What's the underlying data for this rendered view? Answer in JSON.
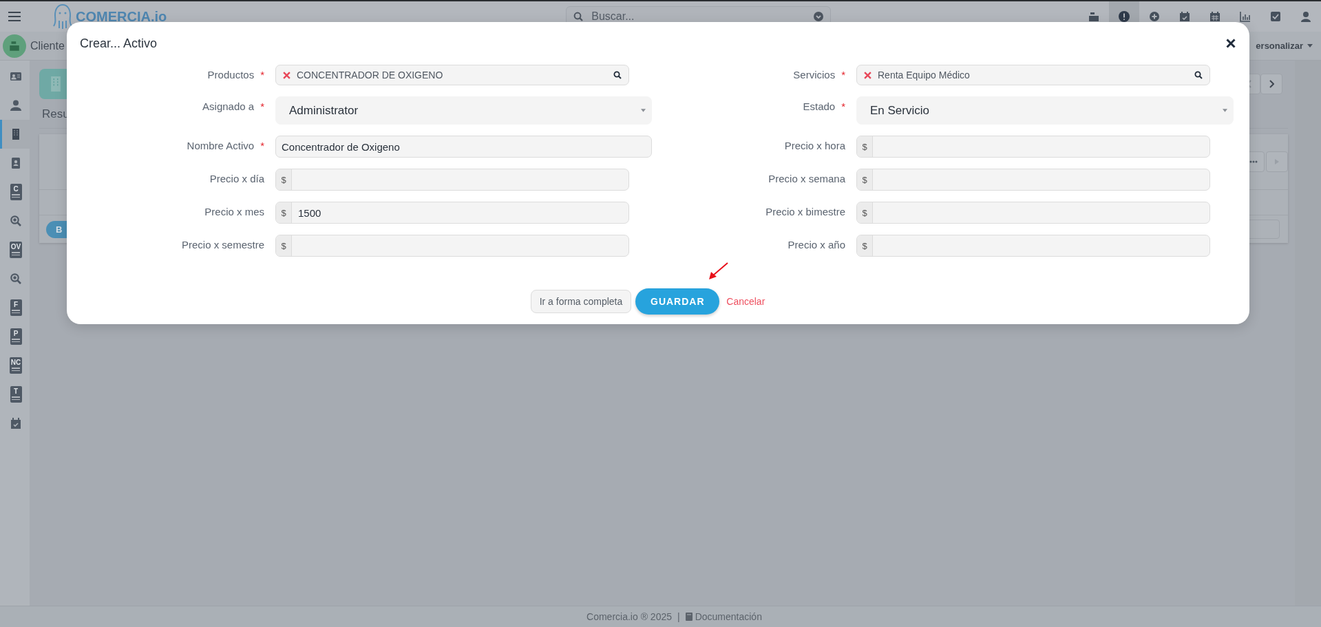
{
  "topbar": {
    "logo": "COMERCIA.io",
    "search": {
      "placeholder": "Buscar..."
    },
    "toolbar": [
      {
        "kind": "register",
        "selected": false
      },
      {
        "kind": "alert",
        "selected": true
      },
      {
        "kind": "plus",
        "selected": false
      },
      {
        "kind": "calendar-check",
        "selected": false
      },
      {
        "kind": "calendar",
        "selected": false
      },
      {
        "kind": "chart",
        "selected": false
      },
      {
        "kind": "checkbox",
        "selected": false
      },
      {
        "kind": "user",
        "selected": false
      }
    ]
  },
  "header": {
    "title": "Cliente",
    "menu": "ersonalizar"
  },
  "sidebar": {
    "items": [
      {
        "kind": "id-card",
        "selected": false
      },
      {
        "kind": "person",
        "selected": false
      },
      {
        "kind": "building",
        "selected": true
      },
      {
        "kind": "contact",
        "selected": false
      },
      {
        "kind": "doc",
        "letter": "C",
        "selected": false
      },
      {
        "kind": "money-search",
        "selected": false
      },
      {
        "kind": "doc",
        "letter": "OV",
        "selected": false
      },
      {
        "kind": "money-search",
        "selected": false
      },
      {
        "kind": "doc",
        "letter": "F",
        "selected": false
      },
      {
        "kind": "doc",
        "letter": "P",
        "selected": false
      },
      {
        "kind": "doc",
        "letter": "NC",
        "selected": false
      },
      {
        "kind": "doc",
        "letter": "T",
        "selected": false
      },
      {
        "kind": "calendar-check",
        "selected": false
      }
    ]
  },
  "background": {
    "tab": "Resu",
    "button": "B"
  },
  "modal": {
    "title": "Crear... Activo",
    "required_mark": "*",
    "left_column": [
      {
        "label": "Productos",
        "required": true,
        "kind": "lookup",
        "value": "CONCENTRADOR DE OXIGENO"
      },
      {
        "label": "Asignado a",
        "required": true,
        "kind": "select",
        "value": "Administrator"
      },
      {
        "label": "Nombre Activo",
        "required": true,
        "kind": "text",
        "value": "Concentrador de Oxigeno"
      },
      {
        "label": "Precio x día",
        "required": false,
        "kind": "money",
        "prefix": "$"
      },
      {
        "label": "Precio x mes",
        "required": false,
        "kind": "money",
        "prefix": "$",
        "value": "1500"
      },
      {
        "label": "Precio x semestre",
        "required": false,
        "kind": "money",
        "prefix": "$"
      }
    ],
    "right_column": [
      {
        "label": "Servicios",
        "required": true,
        "kind": "lookup",
        "value": "Renta Equipo Médico"
      },
      {
        "label": "Estado",
        "required": true,
        "kind": "select",
        "value": "En Servicio"
      },
      {
        "label": "Precio x hora",
        "required": false,
        "kind": "money",
        "prefix": "$"
      },
      {
        "label": "Precio x semana",
        "required": false,
        "kind": "money",
        "prefix": "$"
      },
      {
        "label": "Precio x bimestre",
        "required": false,
        "kind": "money",
        "prefix": "$"
      },
      {
        "label": "Precio x año",
        "required": false,
        "kind": "money",
        "prefix": "$"
      }
    ],
    "buttons": {
      "full_form": "Ir a forma completa",
      "save": "GUARDAR",
      "cancel": "Cancelar"
    }
  },
  "footer": {
    "copyright": "Comercia.io ® 2025",
    "separator": "|",
    "link": "Documentación"
  }
}
